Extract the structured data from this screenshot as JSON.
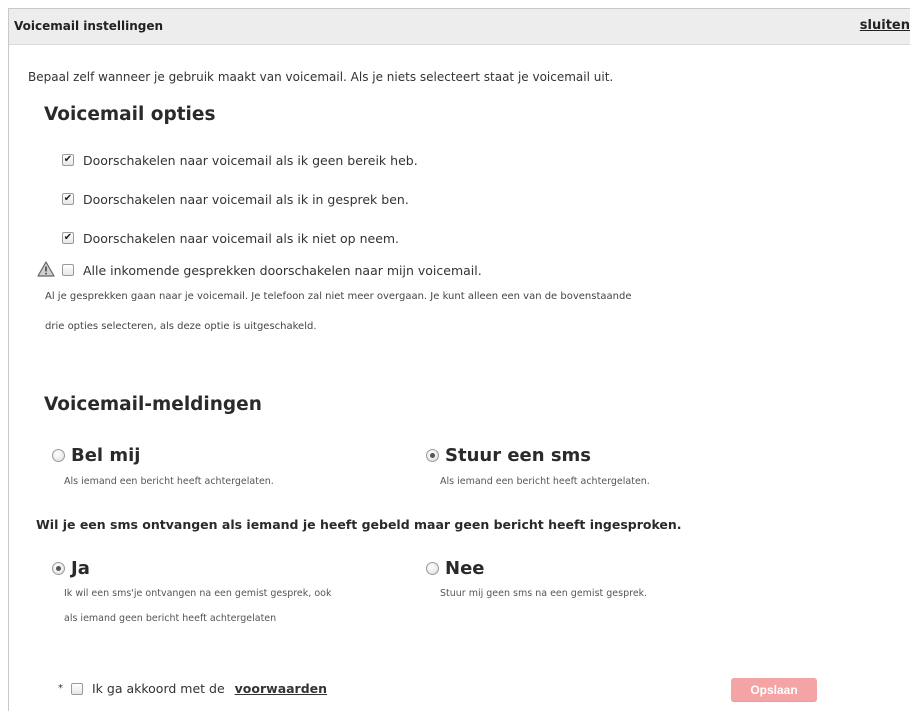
{
  "dialog": {
    "title": "Voicemail instellingen",
    "close_label": "sluiten"
  },
  "intro": "Bepaal zelf wanneer je gebruik maakt van voicemail. Als je niets selecteert staat je voicemail uit.",
  "options_section": {
    "heading": "Voicemail opties",
    "options": [
      {
        "label": "Doorschakelen naar voicemail als ik geen bereik heb.",
        "checked": true
      },
      {
        "label": "Doorschakelen naar voicemail als ik in gesprek ben.",
        "checked": true
      },
      {
        "label": "Doorschakelen naar voicemail als ik niet op neem.",
        "checked": true
      }
    ],
    "all_calls": {
      "label": "Alle inkomende gesprekken doorschakelen naar mijn voicemail.",
      "checked": false,
      "icon": "warning-icon",
      "note_line1": "Al je gesprekken gaan naar je voicemail. Je telefoon zal niet meer overgaan. Je kunt alleen een van de bovenstaande",
      "note_line2": "drie opties selecteren, als deze optie is uitgeschakeld."
    }
  },
  "notifications_section": {
    "heading": "Voicemail-meldingen",
    "call_me": {
      "label": "Bel mij",
      "desc": "Als iemand een bericht heeft achtergelaten.",
      "selected": false
    },
    "send_sms": {
      "label": "Stuur een sms",
      "desc": "Als iemand een bericht heeft achtergelaten.",
      "selected": true
    },
    "question": "Wil je een sms ontvangen als iemand je heeft gebeld maar geen bericht heeft ingesproken.",
    "yes": {
      "label": "Ja",
      "desc_line1": "Ik wil een sms'je ontvangen na een gemist gesprek, ook",
      "desc_line2": "als iemand geen bericht heeft achtergelaten",
      "selected": true
    },
    "no": {
      "label": "Nee",
      "desc": "Stuur mij geen sms na een gemist gesprek.",
      "selected": false
    }
  },
  "footer": {
    "required_marker": "*",
    "agree_label": "Ik ga akkoord met de",
    "terms_link": "voorwaarden",
    "agree_checked": false,
    "save_label": "Opslaan"
  },
  "colors": {
    "save_button": "#f4a4a4",
    "titlebar": "#ededed"
  }
}
